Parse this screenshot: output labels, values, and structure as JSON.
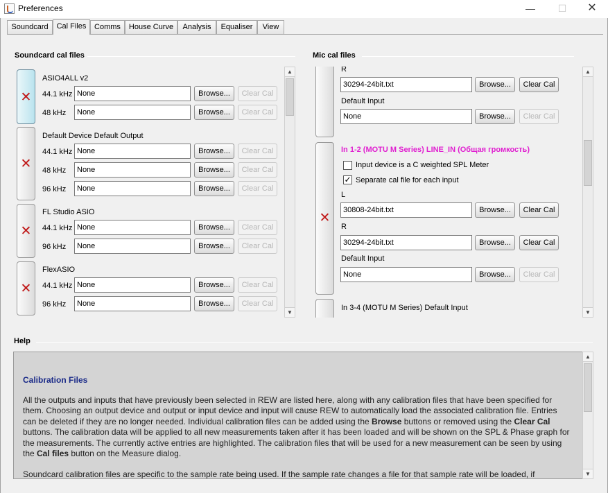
{
  "window": {
    "title": "Preferences",
    "minimize": "—",
    "maximize": "☐",
    "close": "✕"
  },
  "tabs": [
    "Soundcard",
    "Cal Files",
    "Comms",
    "House Curve",
    "Analysis",
    "Equaliser",
    "View"
  ],
  "soundcard_section": {
    "title": "Soundcard cal files",
    "devices": [
      {
        "name": "ASIO4ALL v2",
        "active": true,
        "rates": [
          {
            "rate": "44.1 kHz",
            "file": "None"
          },
          {
            "rate": "48 kHz",
            "file": "None"
          }
        ]
      },
      {
        "name": "Default Device Default Output",
        "active": false,
        "rates": [
          {
            "rate": "44.1 kHz",
            "file": "None"
          },
          {
            "rate": "48 kHz",
            "file": "None"
          },
          {
            "rate": "96 kHz",
            "file": "None"
          }
        ]
      },
      {
        "name": "FL Studio ASIO",
        "active": false,
        "rates": [
          {
            "rate": "44.1 kHz",
            "file": "None"
          },
          {
            "rate": "96 kHz",
            "file": "None"
          }
        ]
      },
      {
        "name": "FlexASIO",
        "active": false,
        "rates": [
          {
            "rate": "44.1 kHz",
            "file": "None"
          },
          {
            "rate": "96 kHz",
            "file": "None"
          }
        ]
      }
    ]
  },
  "mic_section": {
    "title": "Mic cal files",
    "top_partial": {
      "r_label": "R",
      "r_file": "30294-24bit.txt",
      "default_label": "Default Input",
      "default_file": "None"
    },
    "active_input": {
      "name": "In 1-2 (MOTU M Series) LINE_IN (Общая громкость)",
      "c_weighted_label": "Input device is a C weighted SPL Meter",
      "c_weighted_checked": false,
      "separate_label": "Separate cal file for each input",
      "separate_checked": true,
      "l_label": "L",
      "l_file": "30808-24bit.txt",
      "r_label": "R",
      "r_file": "30294-24bit.txt",
      "default_label": "Default Input",
      "default_file": "None"
    },
    "next_input": {
      "name": "In 3-4 (MOTU M Series) Default Input"
    }
  },
  "buttons": {
    "browse": "Browse...",
    "clear": "Clear Cal",
    "delete_glyph": "✕",
    "check_glyph": "✓"
  },
  "help": {
    "section_title": "Help",
    "heading": "Calibration Files",
    "paragraph1": [
      {
        "t": "All the outputs and inputs that have previously been selected in REW are listed here, along with any calibration files that have been specified for them. Choosing an output device and output or input device and input will cause REW to automatically load the associated calibration file. Entries can be deleted if they are no longer needed. Individual calibration files can be added using the "
      },
      {
        "t": "Browse",
        "b": true
      },
      {
        "t": " buttons or removed using the "
      },
      {
        "t": "Clear Cal",
        "b": true
      },
      {
        "t": " buttons. The calibration data will be applied to all new measurements taken after it has been loaded and will be shown on the SPL & Phase graph for the measurements. The currently active entries are highlighted. The calibration files that will be used for a new measurement can be seen by using the "
      },
      {
        "t": "Cal files",
        "b": true
      },
      {
        "t": " button on the Measure dialog."
      }
    ],
    "paragraph2": "Soundcard calibration files are specific to the sample rate being used. If the sample rate changes a file for that sample rate will be loaded, if available."
  },
  "scroll_arrows": {
    "up": "▲",
    "down": "▼"
  }
}
